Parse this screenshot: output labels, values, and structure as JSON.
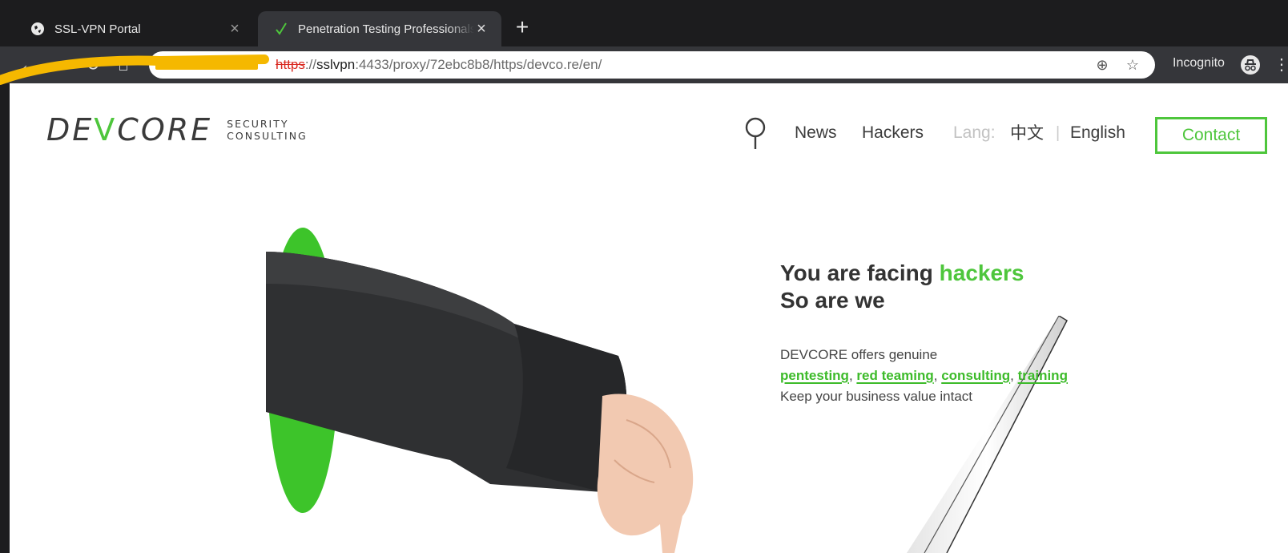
{
  "browser": {
    "tabs": [
      {
        "label": "SSL-VPN Portal",
        "icon": "globe-icon",
        "active": false
      },
      {
        "label": "Penetration Testing Professionals",
        "icon": "devcore-check-icon",
        "active": true
      }
    ],
    "address": {
      "scheme": "https",
      "rest_prefix": "://",
      "host": "sslvpn",
      "path": ":4433/proxy/72ebc8b8/https/devco.re/en/"
    },
    "incognito_label": "Incognito",
    "colors": {
      "chrome_bg": "#35363a",
      "redaction": "#f5b800"
    }
  },
  "site": {
    "logo": {
      "word_left": "DE",
      "word_v": "V",
      "word_right": "CORE",
      "sub_line1": "SECURITY",
      "sub_line2": "CONSULTING"
    },
    "nav": {
      "news": "News",
      "hackers": "Hackers",
      "lang_label": "Lang:",
      "lang_zh": "中文",
      "lang_sep": "|",
      "lang_en": "English",
      "contact": "Contact"
    },
    "hero": {
      "headline_prefix": "You are facing ",
      "headline_highlight": "hackers",
      "headline_line2": "So are we",
      "desc_line1": "DEVCORE offers genuine",
      "links": [
        "pentesting",
        "red teaming",
        "consulting",
        "training"
      ],
      "link_sep": ", ",
      "desc_line3": "Keep your business value intact"
    },
    "colors": {
      "accent": "#4ec63c",
      "text": "#3c3c3c"
    }
  }
}
